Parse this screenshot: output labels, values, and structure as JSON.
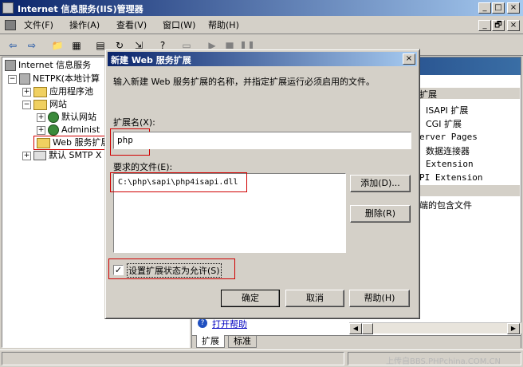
{
  "main_window": {
    "title": "Internet 信息服务(IIS)管理器",
    "caption_buttons": [
      "_",
      "□",
      "×"
    ],
    "menu": [
      "文件(F)",
      "操作(A)",
      "查看(V)",
      "窗口(W)",
      "帮助(H)"
    ],
    "mdi_buttons": [
      "_",
      "🗗",
      "×"
    ]
  },
  "tree": [
    {
      "label": "Internet 信息服务"
    },
    {
      "label": "NETPK(本地计算"
    },
    {
      "label": "应用程序池"
    },
    {
      "label": "网站"
    },
    {
      "label": "默认网站"
    },
    {
      "label": "Administ"
    },
    {
      "label": "Web 服务扩展"
    },
    {
      "label": "默认 SMTP X"
    }
  ],
  "right_panel": {
    "header": "扩展",
    "items": [
      "ISAPI 扩展",
      "CGI 扩展",
      "erver Pages",
      "数据连接器",
      "Extension",
      "PI Extension"
    ],
    "section_text": "端的包含文件",
    "help_link": "打开帮助"
  },
  "bottom_tabs": [
    "扩展",
    "标准"
  ],
  "status_text": "上传自BBS.PHPchina.COM.CN",
  "dialog": {
    "title": "新建 Web 服务扩展",
    "close_label": "×",
    "instruction": "输入新建 Web 服务扩展的名称，并指定扩展运行必须启用的文件。",
    "ext_name_label": "扩展名(X):",
    "ext_name_value": "php",
    "files_label": "要求的文件(E):",
    "files": [
      "C:\\php\\sapi\\php4isapi.dll"
    ],
    "add_button": "添加(D)...",
    "remove_button": "删除(R)",
    "allow_checkbox_label": "设置扩展状态为允许(S)",
    "allow_checked": true,
    "ok_button": "确定",
    "cancel_button": "取消",
    "help_button": "帮助(H)"
  }
}
